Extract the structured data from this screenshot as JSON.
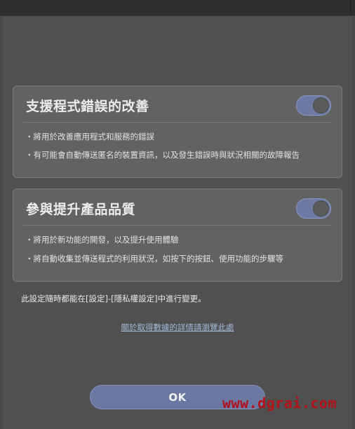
{
  "sections": [
    {
      "title": "支援程式錯誤的改善",
      "enabled": true,
      "bullets": [
        "・將用於改善應用程式和服務的錯誤",
        "・有可能會自動傳送匿名的裝置資訊，以及發生錯誤時與狀況相關的故障報告"
      ]
    },
    {
      "title": "參與提升產品品質",
      "enabled": true,
      "bullets": [
        "・將用於新功能的開發，以及提升使用體驗",
        "・將自動收集並傳送程式的利用狀況，如按下的按鈕、使用功能的步驟等"
      ]
    }
  ],
  "settings_note": "此設定隨時都能在[設定]-[隱私權設定]中進行變更。",
  "details_link": "關於取得數據的詳情請瀏覽此處",
  "ok_label": "OK",
  "watermark": "www.dgrai.com",
  "colors": {
    "accent": "#6a78a2",
    "card": "#626262",
    "background": "#505050",
    "link": "#9fb6d6",
    "watermark": "#b3101a"
  }
}
